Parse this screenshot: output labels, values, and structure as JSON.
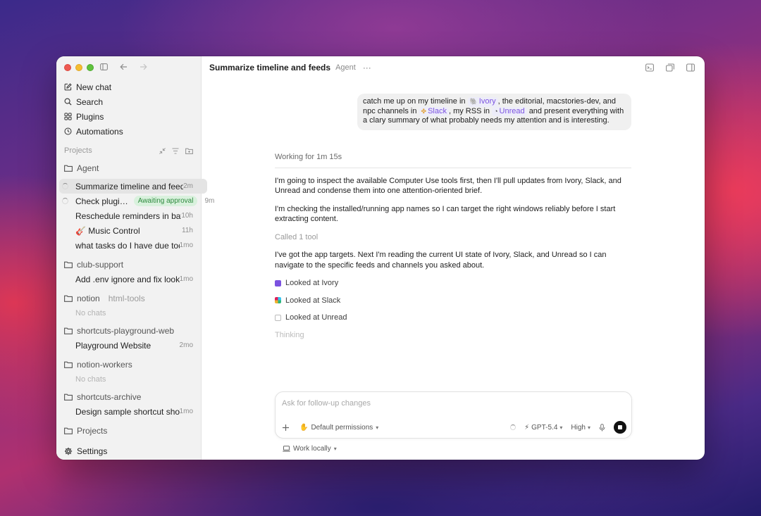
{
  "sidebar": {
    "nav": [
      {
        "label": "New chat",
        "icon": "compose-icon"
      },
      {
        "label": "Search",
        "icon": "search-icon"
      },
      {
        "label": "Plugins",
        "icon": "grid-icon"
      },
      {
        "label": "Automations",
        "icon": "clock-icon"
      }
    ],
    "projects_header": "Projects",
    "groups": [
      {
        "folder": "Agent",
        "chats": [
          {
            "title": "Summarize timeline and feeds",
            "age": "2m"
          },
          {
            "title": "Check plugi…",
            "badge": "Awaiting approval",
            "age": "9m"
          },
          {
            "title": "Reschedule reminders in batches",
            "age": "10h"
          },
          {
            "title": "🎸 Music Control",
            "age": "11h"
          },
          {
            "title": "what tasks do I have due today",
            "age": "1mo"
          }
        ]
      },
      {
        "folder": "club-support",
        "chats": [
          {
            "title": "Add .env ignore and fix lookup",
            "age": "1mo"
          }
        ]
      },
      {
        "folder": "notion",
        "folder_sub": "html-tools",
        "no_chats": "No chats"
      },
      {
        "folder": "shortcuts-playground-web",
        "chats": [
          {
            "title": "Playground Website",
            "age": "2mo"
          }
        ]
      },
      {
        "folder": "notion-workers",
        "no_chats": "No chats"
      },
      {
        "folder": "shortcuts-archive",
        "chats": [
          {
            "title": "Design sample shortcut showcase",
            "age": "1mo"
          }
        ]
      },
      {
        "folder": "Projects"
      }
    ],
    "settings": "Settings"
  },
  "header": {
    "title": "Summarize timeline and feeds",
    "subtitle": "Agent",
    "more": "···"
  },
  "user_message": {
    "part1": "catch me up on my timeline in",
    "chip1": "Ivory",
    "part2": ", the editorial, macstories-dev, and npc channels in",
    "chip2": "Slack",
    "part3": ", my RSS in",
    "chip3": "Unread",
    "part4": "and present everything with a clary summary of what probably needs my attention and is interesting."
  },
  "thread": {
    "working": "Working for 1m 15s",
    "p1": "I'm going to inspect the available Computer Use tools first, then I'll pull updates from Ivory, Slack, and Unread and condense them into one attention-oriented brief.",
    "p2": "I'm checking the installed/running app names so I can target the right windows reliably before I start extracting content.",
    "called": "Called 1 tool",
    "p3": "I've got the app targets. Next I'm reading the current UI state of Ivory, Slack, and Unread so I can navigate to the specific feeds and channels you asked about.",
    "tools": [
      "Looked at Ivory",
      "Looked at Slack",
      "Looked at Unread"
    ],
    "thinking": "Thinking"
  },
  "composer": {
    "placeholder": "Ask for follow-up changes",
    "permissions": "Default permissions",
    "model": "GPT-5.4",
    "effort": "High"
  },
  "footer": {
    "work_locally": "Work locally"
  },
  "colors": {
    "accent_purple": "#7b52e0",
    "badge_green": "#2f8b3f",
    "stop": "#111111"
  }
}
